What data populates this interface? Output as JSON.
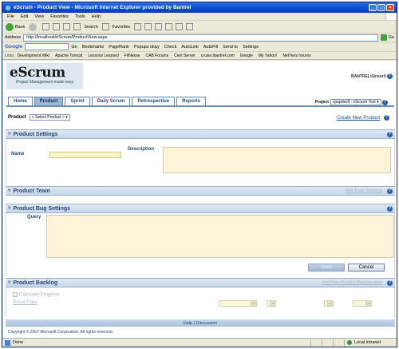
{
  "window": {
    "title": "eScrum - Product View - Microsoft Internet Explorer provided by Bantrel"
  },
  "menu": [
    "File",
    "Edit",
    "View",
    "Favorites",
    "Tools",
    "Help"
  ],
  "toolbar": {
    "back": "Back",
    "search": "Search",
    "favorites": "Favorites"
  },
  "address": {
    "label": "Address",
    "url": "http://localhost/eScrum/ProductView.aspx",
    "go": "Go",
    "links_label": "Links"
  },
  "google_bar": {
    "logo": "Google",
    "go": "Go",
    "items": [
      "Bookmarks",
      "PageRank",
      "Popups okay",
      "Check",
      "AutoLink",
      "AutoFill",
      "Send to",
      "Settings"
    ]
  },
  "links": [
    "Development Wiki",
    "Apache Tomcat",
    "Lessons Learned",
    "FitNesse",
    "CAB Forums",
    "Cent Server",
    "cruise.ibantrel.com",
    "Google",
    "My Yahoo!",
    "NetTiers forums"
  ],
  "app": {
    "logo": "eScrum",
    "tagline": "Project Management made easy.",
    "user": "BANTREL\\Sinsor0",
    "tabs": [
      "Home",
      "Product",
      "Sprint",
      "Daily Scrum",
      "Retrospective",
      "Reports"
    ],
    "active_tab": "Product",
    "project_label": "Project",
    "project_value": "cpupdev9 - eScrum Test",
    "product_label": "Product",
    "product_select": "< Select Product >",
    "create_link": "Create New Product",
    "help_glyph": "?"
  },
  "sections": {
    "settings": {
      "title": "Product Settings",
      "name_label": "Name",
      "description_label": "Description"
    },
    "team": {
      "title": "Product Team",
      "add_link": "Add Team Member"
    },
    "bugs": {
      "title": "Product Bug Settings",
      "query_label": "Query",
      "save": "Save",
      "cancel": "Cancel"
    },
    "backlog": {
      "title": "Product Backlog",
      "add_link": "Add New Product Backlog Item",
      "calc": "Calculate Progress",
      "reset": "Reset Filter"
    }
  },
  "footer": {
    "links": "Help | Discussion",
    "copyright": "Copyright © 2007 Microsoft Corporation. All rights reserved."
  },
  "status": {
    "text": "Done",
    "zone": "Local intranet"
  },
  "colors": {
    "title_bar": "#0a4ad0",
    "section_header": "#c6d6e9",
    "input_bg": "#fdf6c8",
    "link": "#1a4aa0"
  }
}
